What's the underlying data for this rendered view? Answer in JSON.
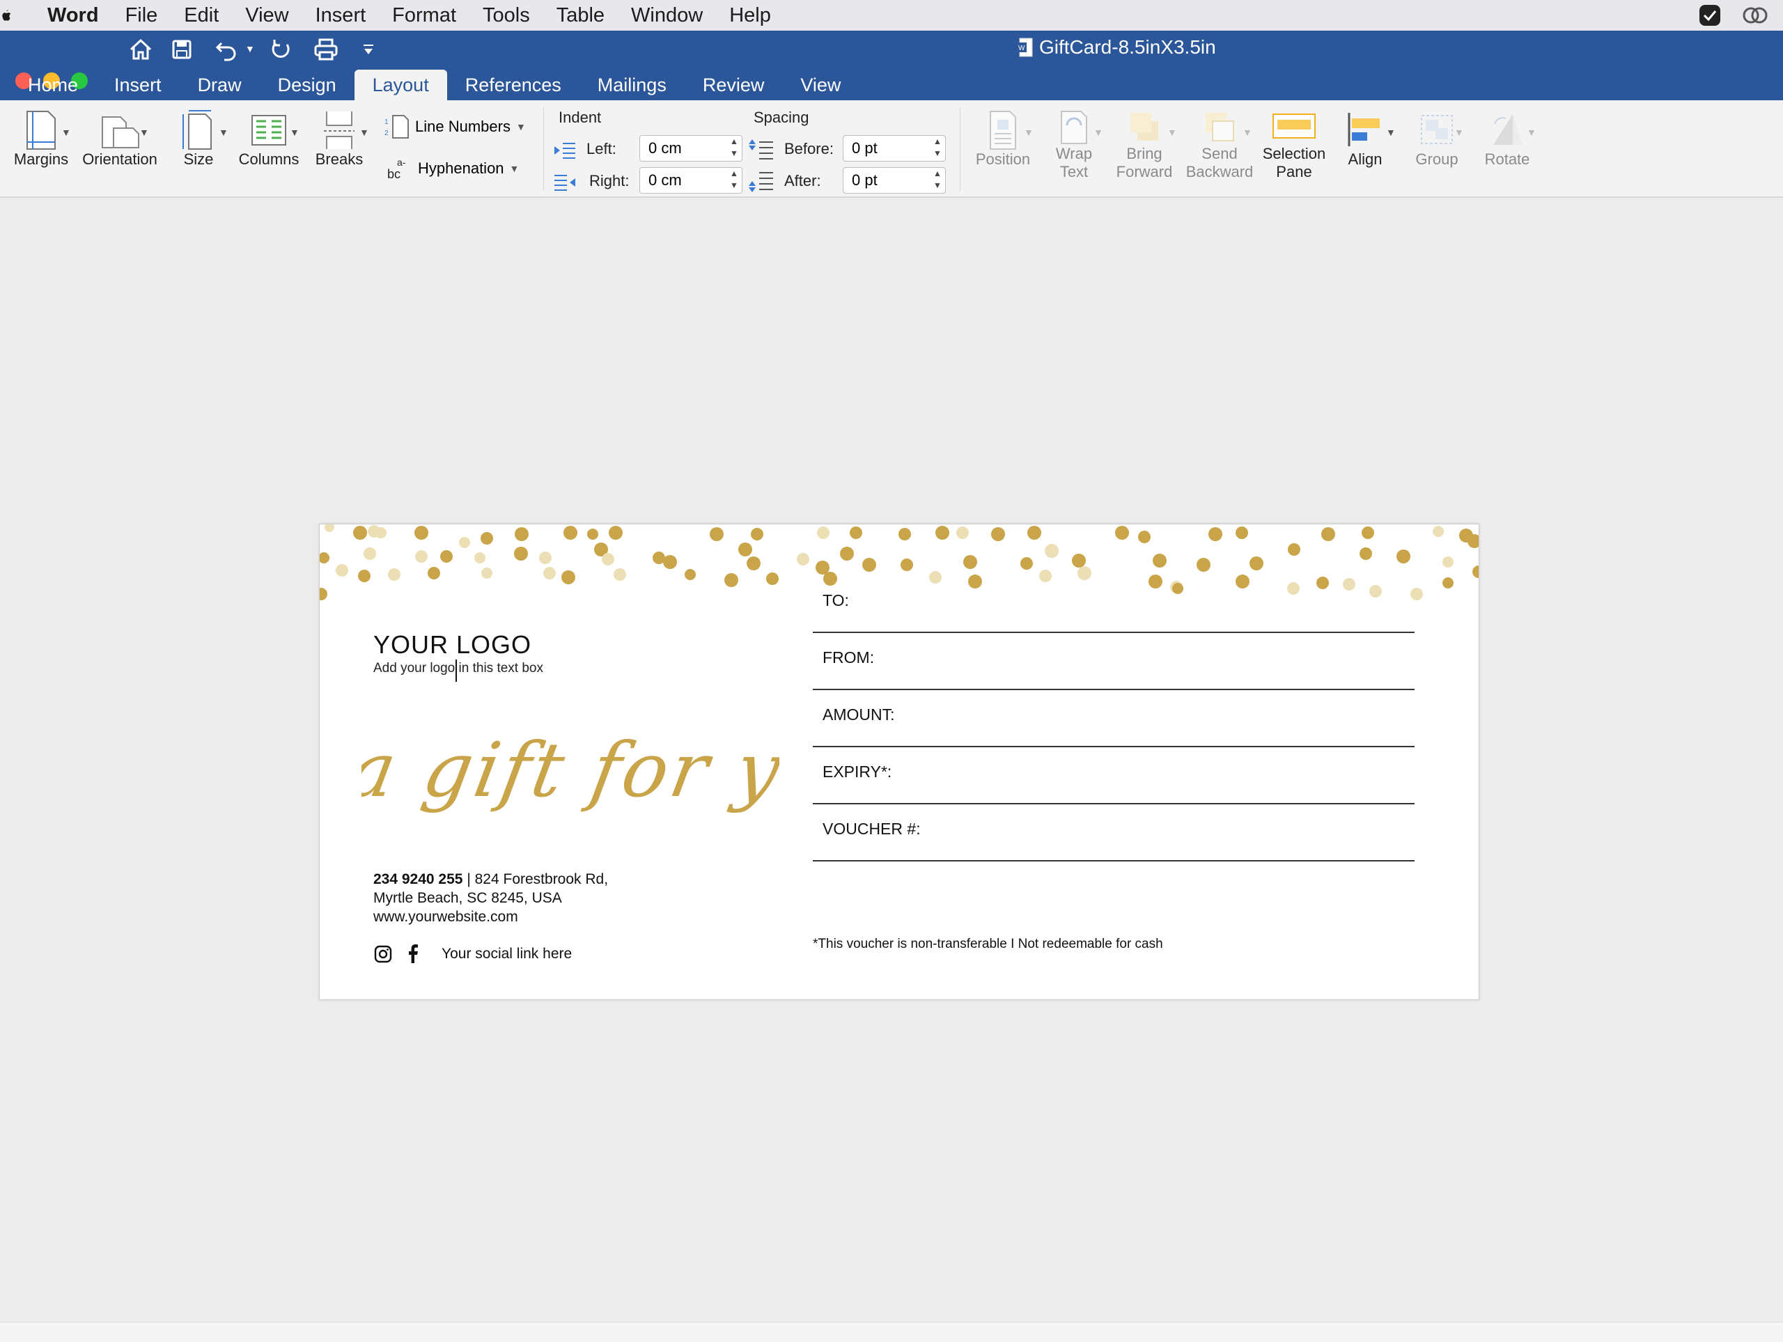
{
  "menubar": {
    "items": [
      "Word",
      "File",
      "Edit",
      "View",
      "Insert",
      "Format",
      "Tools",
      "Table",
      "Window",
      "Help"
    ]
  },
  "window": {
    "title": "GiftCard-8.5inX3.5in"
  },
  "tabs": [
    "Home",
    "Insert",
    "Draw",
    "Design",
    "Layout",
    "References",
    "Mailings",
    "Review",
    "View"
  ],
  "ribbon": {
    "margins": "Margins",
    "orientation": "Orientation",
    "size": "Size",
    "columns": "Columns",
    "breaks": "Breaks",
    "line_numbers": "Line Numbers",
    "hyphenation": "Hyphenation",
    "indent_title": "Indent",
    "indent_left_label": "Left:",
    "indent_left_value": "0 cm",
    "indent_right_label": "Right:",
    "indent_right_value": "0 cm",
    "spacing_title": "Spacing",
    "spacing_before_label": "Before:",
    "spacing_before_value": "0 pt",
    "spacing_after_label": "After:",
    "spacing_after_value": "0 pt",
    "position": "Position",
    "wrap_text_1": "Wrap",
    "wrap_text_2": "Text",
    "bring_forward_1": "Bring",
    "bring_forward_2": "Forward",
    "send_backward_1": "Send",
    "send_backward_2": "Backward",
    "selection_pane_1": "Selection",
    "selection_pane_2": "Pane",
    "align": "Align",
    "group": "Group",
    "rotate": "Rotate"
  },
  "card": {
    "logo": "YOUR LOGO",
    "logo_sub": "Add your logo in this text box",
    "script": "a gift for you",
    "phone": "234 9240 255",
    "address_1": "824 Forestbrook Rd,",
    "address_2": "Myrtle Beach, SC 8245, USA",
    "website": "www.yourwebsite.com",
    "social": "Your social link here",
    "fields": [
      "TO:",
      "FROM:",
      "AMOUNT:",
      "EXPIRY*:",
      "VOUCHER #:"
    ],
    "note": "*This voucher is non-transferable I Not redeemable for cash"
  },
  "colors": {
    "word_blue": "#2b579a",
    "gold": "#c9a448",
    "gold_light": "#ecdfb5"
  }
}
